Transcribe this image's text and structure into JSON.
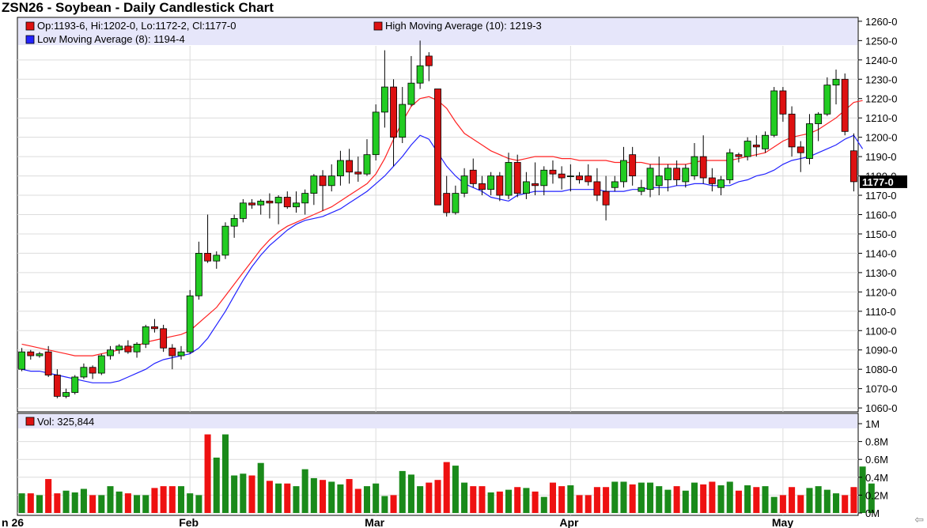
{
  "title": "ZSN26 - Soybean - Daily Candlestick Chart",
  "legend": {
    "ohlc": "Op:1193-6, Hi:1202-0, Lo:1172-2, Cl:1177-0",
    "high_ma": "High Moving Average (10): 1219-3",
    "low_ma": "Low Moving Average (8): 1194-4",
    "volume": "Vol: 325,844"
  },
  "current_price_label": "1177-0",
  "nav_icon": "back-arrow-icon",
  "colors": {
    "up": "#22cc22",
    "down": "#dd1111",
    "high_ma": "#ff2222",
    "low_ma": "#2222ff",
    "legend_band": "#e6e6fa",
    "grid": "#dcdcdc"
  },
  "chart_data": [
    {
      "type": "candlestick",
      "y_ticks": [
        "1060-0",
        "1070-0",
        "1080-0",
        "1090-0",
        "1100-0",
        "1110-0",
        "1120-0",
        "1130-0",
        "1140-0",
        "1150-0",
        "1160-0",
        "1170-0",
        "1180-0",
        "1190-0",
        "1200-0",
        "1210-0",
        "1220-0",
        "1230-0",
        "1240-0",
        "1250-0",
        "1260-0"
      ],
      "ylim": [
        1058,
        1262
      ],
      "x_labels": [
        "n 26",
        "Feb",
        "Mar",
        "Apr",
        "May"
      ],
      "grid": true,
      "candles": [
        [
          1080,
          1091,
          1079,
          1089
        ],
        [
          1089,
          1090,
          1085,
          1087
        ],
        [
          1087,
          1089,
          1086,
          1088
        ],
        [
          1089,
          1092,
          1076,
          1077
        ],
        [
          1077,
          1080,
          1065,
          1066
        ],
        [
          1066,
          1070,
          1065,
          1068
        ],
        [
          1068,
          1077,
          1067,
          1076
        ],
        [
          1076,
          1083,
          1075,
          1081
        ],
        [
          1081,
          1082,
          1075,
          1078
        ],
        [
          1078,
          1088,
          1077,
          1087
        ],
        [
          1087,
          1092,
          1085,
          1090
        ],
        [
          1090,
          1093,
          1088,
          1092
        ],
        [
          1092,
          1095,
          1088,
          1089
        ],
        [
          1089,
          1094,
          1086,
          1093
        ],
        [
          1093,
          1103,
          1091,
          1102
        ],
        [
          1102,
          1106,
          1099,
          1101
        ],
        [
          1101,
          1103,
          1089,
          1091
        ],
        [
          1091,
          1093,
          1080,
          1087
        ],
        [
          1087,
          1092,
          1085,
          1089
        ],
        [
          1089,
          1121,
          1088,
          1118
        ],
        [
          1118,
          1146,
          1116,
          1140
        ],
        [
          1140,
          1160,
          1135,
          1136
        ],
        [
          1136,
          1141,
          1132,
          1139
        ],
        [
          1139,
          1156,
          1137,
          1154
        ],
        [
          1154,
          1160,
          1148,
          1158
        ],
        [
          1158,
          1168,
          1156,
          1166
        ],
        [
          1166,
          1168,
          1163,
          1165
        ],
        [
          1165,
          1168,
          1160,
          1167
        ],
        [
          1167,
          1171,
          1158,
          1166
        ],
        [
          1166,
          1170,
          1155,
          1169
        ],
        [
          1169,
          1172,
          1163,
          1164
        ],
        [
          1164,
          1172,
          1161,
          1166
        ],
        [
          1166,
          1173,
          1160,
          1171
        ],
        [
          1171,
          1181,
          1165,
          1180
        ],
        [
          1180,
          1183,
          1162,
          1175
        ],
        [
          1175,
          1186,
          1172,
          1180
        ],
        [
          1180,
          1193,
          1175,
          1188
        ],
        [
          1188,
          1194,
          1176,
          1182
        ],
        [
          1182,
          1190,
          1177,
          1181
        ],
        [
          1181,
          1199,
          1180,
          1191
        ],
        [
          1191,
          1217,
          1188,
          1213
        ],
        [
          1213,
          1245,
          1205,
          1226
        ],
        [
          1226,
          1230,
          1185,
          1200
        ],
        [
          1200,
          1226,
          1197,
          1217
        ],
        [
          1217,
          1242,
          1216,
          1228
        ],
        [
          1228,
          1250,
          1225,
          1237
        ],
        [
          1242,
          1244,
          1229,
          1237
        ],
        [
          1225,
          1225,
          1165,
          1165
        ],
        [
          1171,
          1180,
          1159,
          1161
        ],
        [
          1161,
          1175,
          1160,
          1171
        ],
        [
          1171,
          1184,
          1169,
          1180
        ],
        [
          1183,
          1189,
          1174,
          1176
        ],
        [
          1176,
          1180,
          1170,
          1173
        ],
        [
          1173,
          1182,
          1170,
          1180
        ],
        [
          1180,
          1182,
          1167,
          1170
        ],
        [
          1170,
          1192,
          1168,
          1187
        ],
        [
          1187,
          1191,
          1169,
          1171
        ],
        [
          1171,
          1182,
          1168,
          1177
        ],
        [
          1176,
          1187,
          1170,
          1175
        ],
        [
          1175,
          1185,
          1170,
          1183
        ],
        [
          1183,
          1188,
          1176,
          1181
        ],
        [
          1181,
          1185,
          1173,
          1179
        ],
        [
          1180,
          1186,
          1172,
          1180
        ],
        [
          1180,
          1182,
          1176,
          1178
        ],
        [
          1180,
          1186,
          1175,
          1177
        ],
        [
          1177,
          1184,
          1167,
          1170
        ],
        [
          1172,
          1180,
          1157,
          1165
        ],
        [
          1174,
          1180,
          1172,
          1177
        ],
        [
          1177,
          1195,
          1174,
          1188
        ],
        [
          1191,
          1195,
          1175,
          1180
        ],
        [
          1172,
          1178,
          1170,
          1174
        ],
        [
          1173,
          1186,
          1169,
          1184
        ],
        [
          1175,
          1190,
          1170,
          1180
        ],
        [
          1178,
          1186,
          1172,
          1184
        ],
        [
          1184,
          1188,
          1175,
          1178
        ],
        [
          1177,
          1186,
          1174,
          1184
        ],
        [
          1180,
          1197,
          1178,
          1190
        ],
        [
          1190,
          1201,
          1176,
          1179
        ],
        [
          1179,
          1184,
          1172,
          1176
        ],
        [
          1174,
          1180,
          1170,
          1178
        ],
        [
          1178,
          1194,
          1176,
          1192
        ],
        [
          1191,
          1192,
          1187,
          1190
        ],
        [
          1190,
          1200,
          1188,
          1198
        ],
        [
          1196,
          1201,
          1190,
          1195
        ],
        [
          1194,
          1203,
          1192,
          1201
        ],
        [
          1201,
          1226,
          1200,
          1224
        ],
        [
          1224,
          1226,
          1208,
          1212
        ],
        [
          1212,
          1216,
          1190,
          1195
        ],
        [
          1195,
          1198,
          1182,
          1192
        ],
        [
          1189,
          1212,
          1186,
          1207
        ],
        [
          1207,
          1213,
          1198,
          1212
        ],
        [
          1212,
          1231,
          1211,
          1227
        ],
        [
          1227,
          1235,
          1217,
          1230
        ],
        [
          1230,
          1233,
          1201,
          1203
        ],
        [
          1193,
          1202,
          1172,
          1177
        ]
      ],
      "high_ma": [
        1093,
        1092,
        1091,
        1090,
        1089,
        1088,
        1087,
        1087,
        1087,
        1088,
        1089,
        1090,
        1091,
        1092,
        1094,
        1095,
        1096,
        1097,
        1098,
        1100,
        1104,
        1108,
        1112,
        1118,
        1124,
        1130,
        1136,
        1142,
        1147,
        1151,
        1154,
        1156,
        1158,
        1160,
        1162,
        1164,
        1167,
        1170,
        1173,
        1176,
        1181,
        1189,
        1199,
        1208,
        1216,
        1220,
        1221,
        1219,
        1215,
        1208,
        1202,
        1199,
        1196,
        1193,
        1191,
        1189,
        1188,
        1189,
        1190,
        1190,
        1190,
        1189,
        1189,
        1188,
        1188,
        1188,
        1188,
        1187,
        1187,
        1187,
        1187,
        1186,
        1186,
        1186,
        1186,
        1186,
        1187,
        1188,
        1188,
        1188,
        1188,
        1189,
        1190,
        1191,
        1192,
        1195,
        1198,
        1200,
        1201,
        1202,
        1204,
        1207,
        1210,
        1214,
        1218,
        1219
      ],
      "low_ma": [
        1080,
        1079,
        1079,
        1078,
        1077,
        1076,
        1075,
        1074,
        1073,
        1073,
        1073,
        1074,
        1076,
        1078,
        1080,
        1083,
        1085,
        1086,
        1087,
        1088,
        1091,
        1096,
        1103,
        1110,
        1118,
        1126,
        1133,
        1139,
        1144,
        1148,
        1152,
        1155,
        1157,
        1158,
        1159,
        1161,
        1163,
        1166,
        1169,
        1172,
        1176,
        1180,
        1185,
        1190,
        1196,
        1201,
        1199,
        1192,
        1185,
        1180,
        1176,
        1174,
        1172,
        1169,
        1168,
        1167,
        1170,
        1171,
        1172,
        1172,
        1172,
        1172,
        1173,
        1173,
        1173,
        1173,
        1172,
        1172,
        1172,
        1173,
        1173,
        1174,
        1174,
        1174,
        1175,
        1175,
        1176,
        1176,
        1175,
        1175,
        1175,
        1177,
        1178,
        1180,
        1181,
        1183,
        1186,
        1188,
        1189,
        1190,
        1192,
        1194,
        1196,
        1199,
        1201,
        1194
      ]
    },
    {
      "type": "bar",
      "series_name": "Vol",
      "y_ticks": [
        "0M",
        "0.2M",
        "0.4M",
        "0.6M",
        "0.8M",
        "1M"
      ],
      "ylim": [
        0,
        1
      ],
      "values": [
        0.22,
        0.22,
        0.2,
        0.38,
        0.22,
        0.25,
        0.23,
        0.27,
        0.2,
        0.2,
        0.3,
        0.24,
        0.22,
        0.2,
        0.2,
        0.28,
        0.3,
        0.3,
        0.3,
        0.22,
        0.2,
        0.88,
        0.62,
        0.88,
        0.42,
        0.44,
        0.42,
        0.56,
        0.36,
        0.33,
        0.33,
        0.3,
        0.49,
        0.39,
        0.37,
        0.35,
        0.32,
        0.38,
        0.27,
        0.3,
        0.33,
        0.19,
        0.2,
        0.47,
        0.43,
        0.3,
        0.34,
        0.37,
        0.57,
        0.53,
        0.34,
        0.3,
        0.3,
        0.23,
        0.24,
        0.26,
        0.29,
        0.28,
        0.24,
        0.18,
        0.34,
        0.3,
        0.31,
        0.2,
        0.2,
        0.29,
        0.29,
        0.35,
        0.35,
        0.32,
        0.34,
        0.34,
        0.3,
        0.26,
        0.3,
        0.25,
        0.34,
        0.32,
        0.35,
        0.31,
        0.35,
        0.25,
        0.31,
        0.29,
        0.3,
        0.18,
        0.2,
        0.29,
        0.2,
        0.28,
        0.3,
        0.26,
        0.22,
        0.2,
        0.29,
        0.52,
        0.33
      ],
      "color_by_candle": true
    }
  ]
}
